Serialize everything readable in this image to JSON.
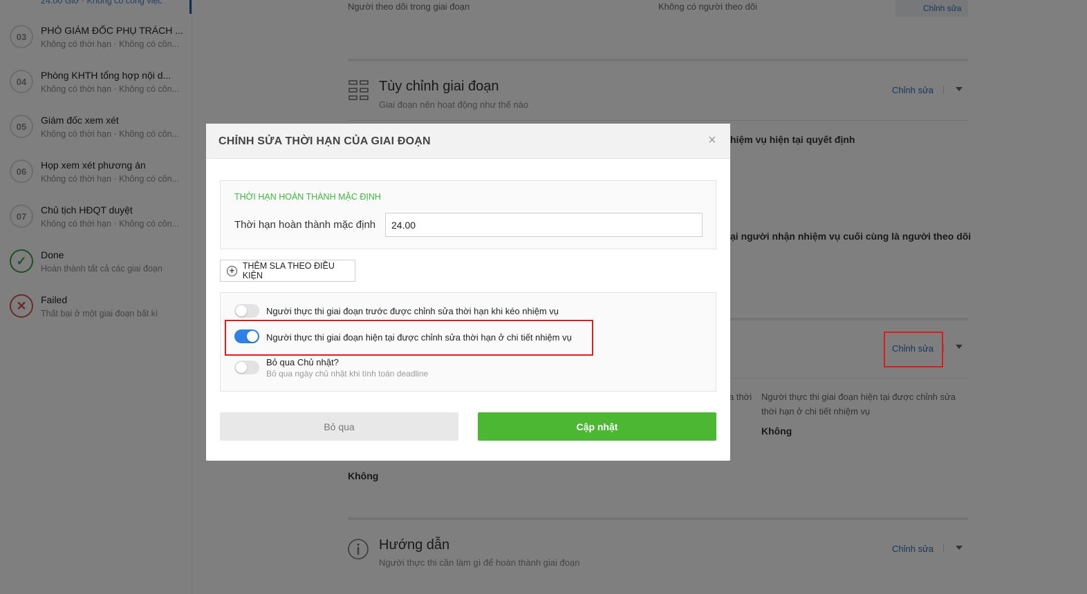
{
  "sidebar": {
    "top_sub": "24.00 Giờ · Không có công việc",
    "items": [
      {
        "num": "03",
        "title": "PHÓ GIÁM ĐỐC PHỤ TRÁCH ...",
        "sub": "Không có thời hạn · Không có côn..."
      },
      {
        "num": "04",
        "title": "Phòng KHTH tổng hợp nội d...",
        "sub": "Không có thời hạn · Không có côn..."
      },
      {
        "num": "05",
        "title": "Giám đốc xem xét",
        "sub": "Không có thời hạn · Không có côn..."
      },
      {
        "num": "06",
        "title": "Họp xem xét phương án",
        "sub": "Không có thời hạn · Không có côn..."
      },
      {
        "num": "07",
        "title": "Chủ tịch HĐQT duyệt",
        "sub": "Không có thời hạn · Không có côn..."
      },
      {
        "num": "✓",
        "title": "Done",
        "sub": "Hoàn thành tất cả các giai đoạn"
      },
      {
        "num": "✕",
        "title": "Failed",
        "sub": "Thất bại ở một giai đoạn bất kì"
      }
    ]
  },
  "main": {
    "follow_label": "Người theo dõi trong giai đoạn",
    "follow_value": "Không có người theo dõi",
    "edit_link": "Chỉnh sửa",
    "custom_title": "Tùy chỉnh giai đoạn",
    "custom_sub": "Giai đoạn nên hoạt động như thế nào",
    "text_decide": "hiệm vụ hiện tại quyết định",
    "text_last_assignee": "ại người nhận nhiệm vụ cuối cùng là người theo dõi",
    "deadline_edit_link": "Chỉnh sửa",
    "fragment_thoi": "a thời",
    "right_desc_line1": "Người thực thi giai đoạn hiện tại được chỉnh sửa",
    "right_desc_line2": "thời hạn ở chi tiết nhiệm vụ",
    "right_value": "Không",
    "left_value": "Không",
    "guide_title": "Hướng dẫn",
    "guide_sub": "Người thực thi cần làm gì để hoàn thành giai đoạn",
    "guide_edit_link": "Chỉnh sửa"
  },
  "modal": {
    "title": "CHỈNH SỬA THỜI HẠN CỦA GIAI ĐOẠN",
    "section_label": "THỜI HẠN HOÀN THÀNH MẶC ĐỊNH",
    "field_label": "Thời hạn hoàn thành mặc định",
    "field_value": "24.00",
    "add_sla_label": "THÊM SLA THEO ĐIỀU KIỆN",
    "toggles": [
      {
        "label": "Người thực thi giai đoạn trước được chỉnh sửa thời hạn khi kéo nhiệm vụ",
        "on": false
      },
      {
        "label": "Người thực thi giai đoạn hiện tại được chỉnh sửa thời hạn ở chi tiết nhiệm vụ",
        "on": true
      },
      {
        "label": "Bỏ qua Chủ nhật?",
        "sub": "Bỏ qua ngày chủ nhật khi tính toán deadline",
        "on": false
      }
    ],
    "cancel_label": "Bỏ qua",
    "save_label": "Cập nhật"
  },
  "colors": {
    "primary_link": "#2a6db8",
    "accent_green": "#4cb732",
    "toggle_on": "#2f80e8",
    "highlight_red": "#e01b1b"
  }
}
